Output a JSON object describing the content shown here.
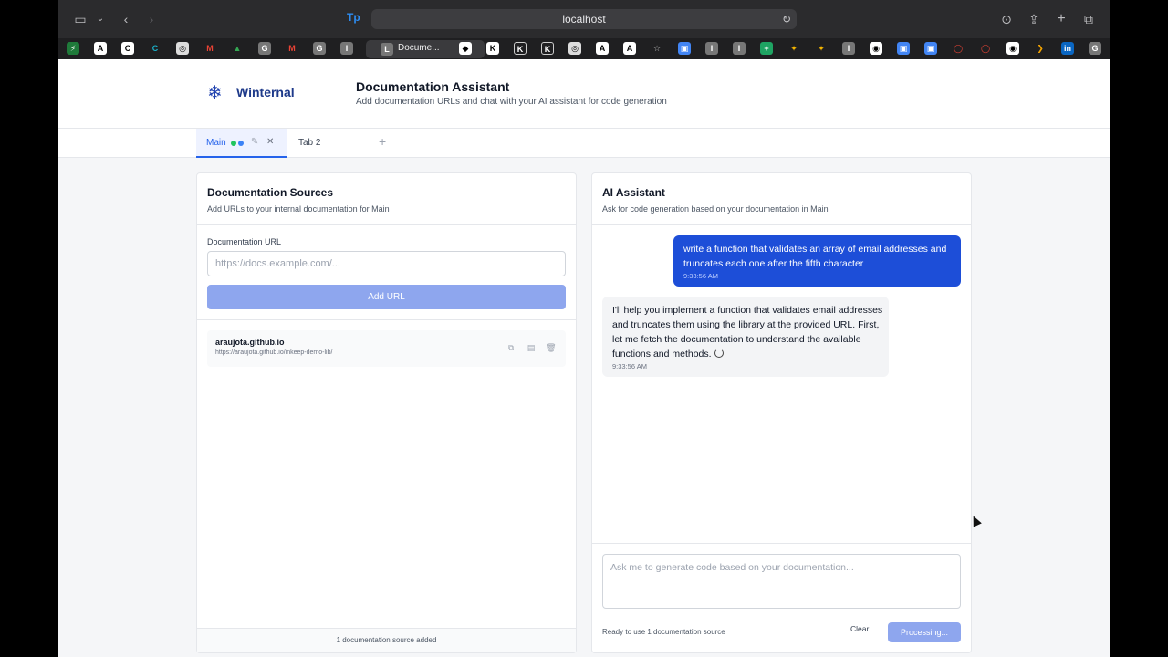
{
  "browser": {
    "url": "localhost",
    "tab_title": "Docume...",
    "toolbar_icons": [
      "sidebar-icon",
      "chevron-down-icon",
      "back-icon",
      "forward-icon",
      "download-icon",
      "share-icon",
      "new-tab-icon",
      "tabs-overview-icon"
    ]
  },
  "header": {
    "brand": "Winternal",
    "title": "Documentation Assistant",
    "subtitle": "Add documentation URLs and chat with your AI assistant for code generation"
  },
  "tabs": [
    {
      "label": "Main",
      "active": true
    },
    {
      "label": "Tab 2",
      "active": false
    }
  ],
  "sources_panel": {
    "title": "Documentation Sources",
    "subtitle": "Add URLs to your internal documentation for Main",
    "field_label": "Documentation URL",
    "input_placeholder": "https://docs.example.com/...",
    "input_value": "",
    "add_button": "Add URL",
    "sources": [
      {
        "name": "araujota.github.io",
        "url": "https://araujota.github.io/inkeep-demo-lib/"
      }
    ],
    "footer": "1 documentation source added"
  },
  "assistant_panel": {
    "title": "AI Assistant",
    "subtitle": "Ask for code generation based on your documentation in Main",
    "messages": [
      {
        "role": "user",
        "text": "write a function that validates an array of email addresses and truncates each one after the fifth character",
        "time": "9:33:56 AM"
      },
      {
        "role": "assistant",
        "text": "I'll help you implement a function that validates email addresses and truncates them using the library at the provided URL. First, let me fetch the documentation to understand the available functions and methods.",
        "time": "9:33:56 AM"
      }
    ],
    "input_placeholder": "Ask me to generate code based on your documentation...",
    "status": "Ready to use 1 documentation source",
    "clear_button": "Clear",
    "submit_button": "Processing..."
  },
  "colors": {
    "accent": "#2563eb",
    "user_bubble": "#1d4ed8",
    "disabled_button": "#8ea6ee",
    "status_dot_green": "#22c55e",
    "status_dot_blue": "#3b82f6"
  }
}
